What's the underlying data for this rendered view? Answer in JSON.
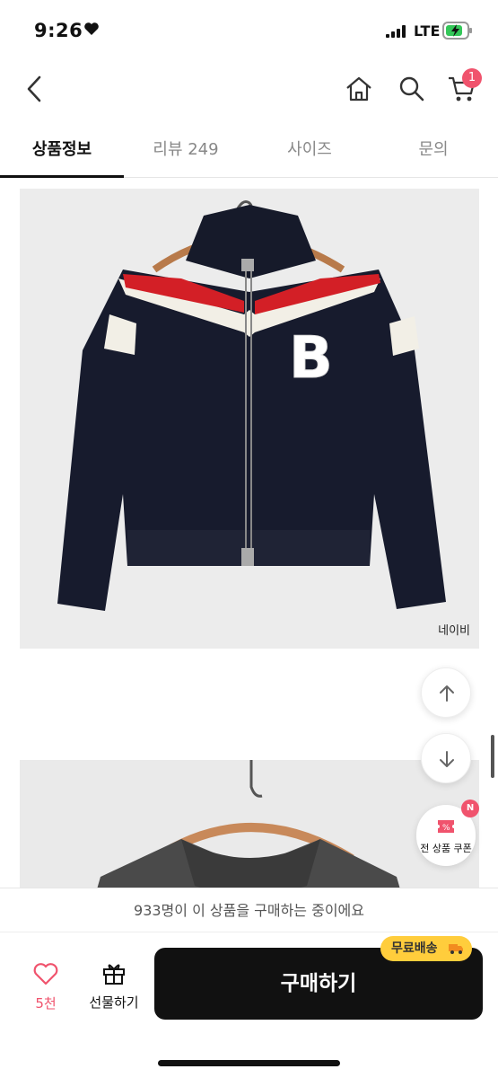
{
  "status": {
    "time": "9:26",
    "network": "LTE"
  },
  "header": {
    "cart_count": "1"
  },
  "tabs": [
    {
      "label": "상품정보"
    },
    {
      "label": "리뷰 249"
    },
    {
      "label": "사이즈"
    },
    {
      "label": "문의"
    }
  ],
  "product": {
    "color_label": "네이비"
  },
  "coupon": {
    "badge": "N",
    "label": "전 상품 쿠폰"
  },
  "notice": {
    "text": "933명이 이 상품을 구매하는 중이에요"
  },
  "bottom": {
    "like_count": "5천",
    "gift_label": "선물하기",
    "buy_label": "구매하기",
    "free_shipping": "무료배송"
  },
  "colors": {
    "accent": "#f0536d",
    "free_badge": "#ffcd3c",
    "buy_button": "#111111"
  },
  "icons": [
    "back-icon",
    "home-icon",
    "search-icon",
    "cart-icon",
    "arrow-up-icon",
    "arrow-down-icon",
    "coupon-icon",
    "heart-outline-icon",
    "gift-icon",
    "truck-icon"
  ]
}
